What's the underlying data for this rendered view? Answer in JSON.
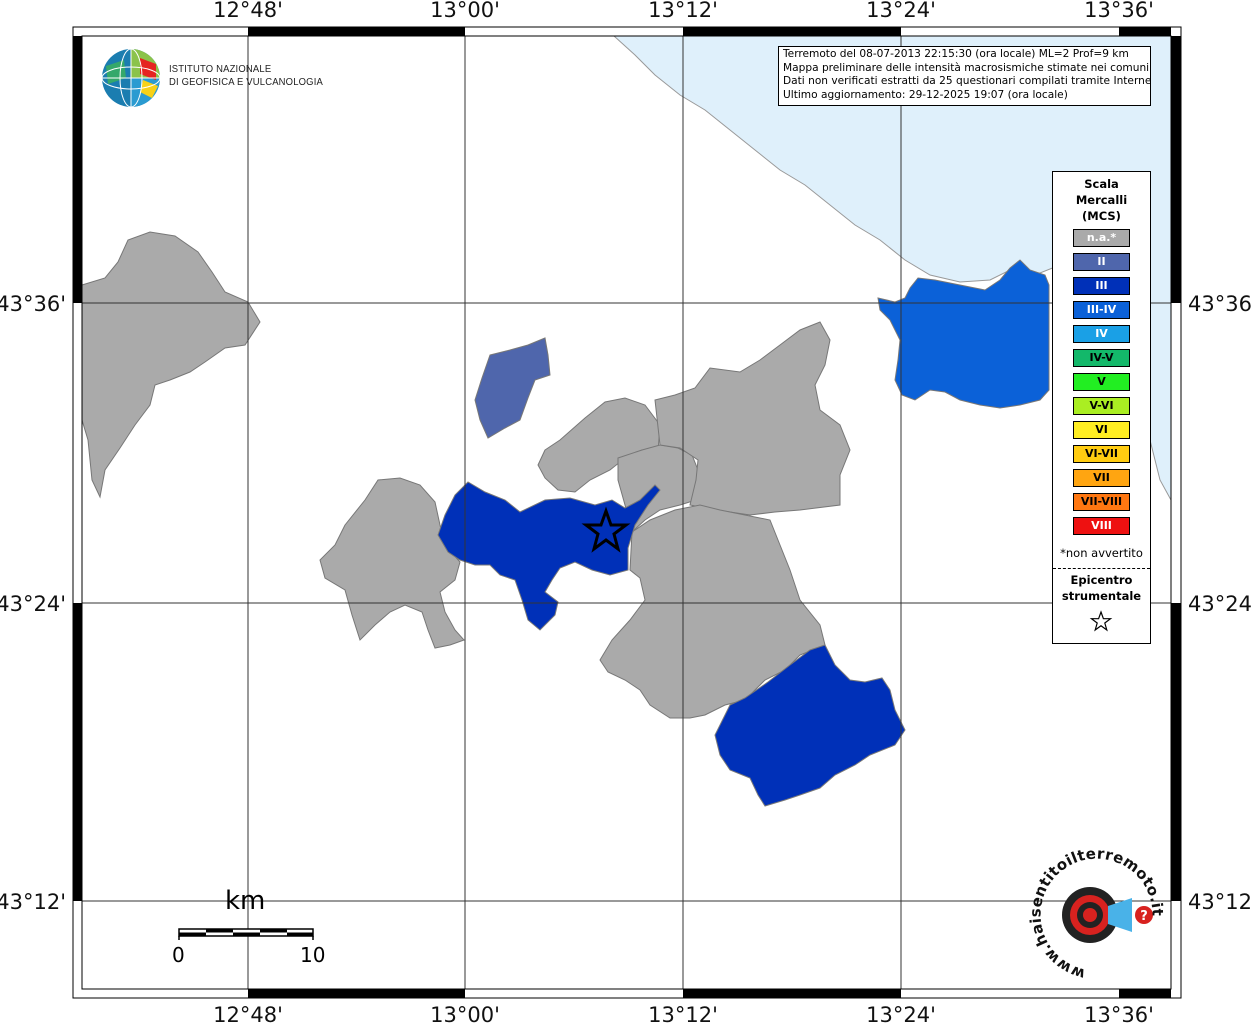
{
  "map": {
    "top_lon_labels": [
      "12°48'",
      "13°00'",
      "13°12'",
      "13°24'",
      "13°36'"
    ],
    "bottom_lon_labels": [
      "12°48'",
      "13°00'",
      "13°12'",
      "13°24'",
      "13°36'"
    ],
    "left_lat_labels": [
      "43°36'",
      "43°24'",
      "43°12'"
    ],
    "right_lat_labels": [
      "43°36'",
      "43°24'",
      "43°12'"
    ],
    "sea_color": "#dff0fb",
    "colors": {
      "not_felt": "#aaaaaa",
      "II": "#4f66ac",
      "III": "#0030b8",
      "III-IV": "#0b61d8"
    }
  },
  "logo": {
    "line1": "ISTITUTO NAZIONALE",
    "line2": "DI GEOFISICA E VULCANOLOGIA"
  },
  "info": {
    "line1": "Terremoto del 08-07-2013 22:15:30 (ora locale) ML=2 Prof=9 km",
    "line2": "Mappa preliminare delle intensità macrosismiche stimate nei comuni",
    "line3": "Dati non verificati estratti da 25 questionari compilati tramite Internet.",
    "line4": "Ultimo aggiornamento: 29-12-2025 19:07 (ora locale)"
  },
  "legend": {
    "title1": "Scala",
    "title2": "Mercalli",
    "title3": "(MCS)",
    "items": [
      {
        "label": "n.a.*",
        "color": "#aaaaaa",
        "text_color": "#ffffff"
      },
      {
        "label": "II",
        "color": "#4f66ac",
        "text_color": "#ffffff"
      },
      {
        "label": "III",
        "color": "#0030b8",
        "text_color": "#ffffff"
      },
      {
        "label": "III-IV",
        "color": "#0b61d8",
        "text_color": "#ffffff"
      },
      {
        "label": "IV",
        "color": "#1aa0e6",
        "text_color": "#ffffff"
      },
      {
        "label": "IV-V",
        "color": "#13b86a",
        "text_color": "#000000"
      },
      {
        "label": "V",
        "color": "#22ee22",
        "text_color": "#000000"
      },
      {
        "label": "V-VI",
        "color": "#aaee22",
        "text_color": "#000000"
      },
      {
        "label": "VI",
        "color": "#ffee22",
        "text_color": "#000000"
      },
      {
        "label": "VI-VII",
        "color": "#ffcc11",
        "text_color": "#000000"
      },
      {
        "label": "VII",
        "color": "#ffa511",
        "text_color": "#000000"
      },
      {
        "label": "VII-VIII",
        "color": "#ff7711",
        "text_color": "#000000"
      },
      {
        "label": "VIII",
        "color": "#ee1111",
        "text_color": "#ffffff"
      }
    ],
    "note": "*non avvertito",
    "epicentre1": "Epicentro",
    "epicentre2": "strumentale"
  },
  "scale_bar": {
    "unit": "km",
    "start": "0",
    "end": "10"
  },
  "badge": {
    "text": "www.haisentitoilterremoto.it"
  }
}
